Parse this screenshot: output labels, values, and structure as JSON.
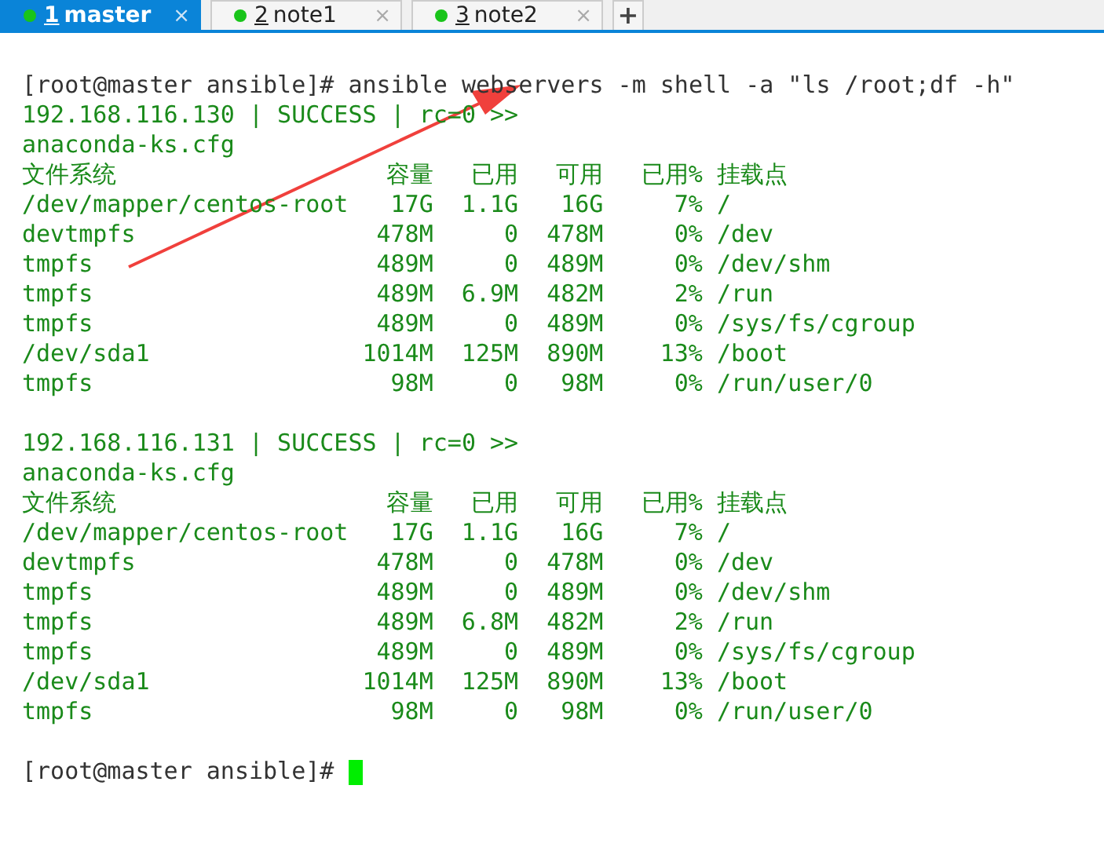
{
  "tabs": [
    {
      "number": "1",
      "label": "master",
      "selected": true,
      "close": "×"
    },
    {
      "number": "2",
      "label": "note1",
      "selected": false,
      "close": "×"
    },
    {
      "number": "3",
      "label": "note2",
      "selected": false,
      "close": "×"
    }
  ],
  "new_tab": "+",
  "terminal": {
    "command": {
      "prompt": "[root@master ansible]#",
      "text": "ansible webservers -m shell -a \"ls /root;df -h\""
    },
    "results": [
      {
        "status_line": "192.168.116.130 | SUCCESS | rc=0 >>",
        "output": "anaconda-ks.cfg",
        "columns": [
          "文件系统",
          "容量",
          "已用",
          "可用",
          "已用%",
          "挂载点"
        ],
        "rows": [
          [
            "/dev/mapper/centos-root",
            "17G",
            "1.1G",
            "16G",
            "7%",
            "/"
          ],
          [
            "devtmpfs",
            "478M",
            "0",
            "478M",
            "0%",
            "/dev"
          ],
          [
            "tmpfs",
            "489M",
            "0",
            "489M",
            "0%",
            "/dev/shm"
          ],
          [
            "tmpfs",
            "489M",
            "6.9M",
            "482M",
            "2%",
            "/run"
          ],
          [
            "tmpfs",
            "489M",
            "0",
            "489M",
            "0%",
            "/sys/fs/cgroup"
          ],
          [
            "/dev/sda1",
            "1014M",
            "125M",
            "890M",
            "13%",
            "/boot"
          ],
          [
            "tmpfs",
            "98M",
            "0",
            "98M",
            "0%",
            "/run/user/0"
          ]
        ]
      },
      {
        "status_line": "192.168.116.131 | SUCCESS | rc=0 >>",
        "output": "anaconda-ks.cfg",
        "columns": [
          "文件系统",
          "容量",
          "已用",
          "可用",
          "已用%",
          "挂载点"
        ],
        "rows": [
          [
            "/dev/mapper/centos-root",
            "17G",
            "1.1G",
            "16G",
            "7%",
            "/"
          ],
          [
            "devtmpfs",
            "478M",
            "0",
            "478M",
            "0%",
            "/dev"
          ],
          [
            "tmpfs",
            "489M",
            "0",
            "489M",
            "0%",
            "/dev/shm"
          ],
          [
            "tmpfs",
            "489M",
            "6.8M",
            "482M",
            "2%",
            "/run"
          ],
          [
            "tmpfs",
            "489M",
            "0",
            "489M",
            "0%",
            "/sys/fs/cgroup"
          ],
          [
            "/dev/sda1",
            "1014M",
            "125M",
            "890M",
            "13%",
            "/boot"
          ],
          [
            "tmpfs",
            "98M",
            "0",
            "98M",
            "0%",
            "/run/user/0"
          ]
        ]
      }
    ],
    "final_prompt": "[root@master ansible]#"
  }
}
